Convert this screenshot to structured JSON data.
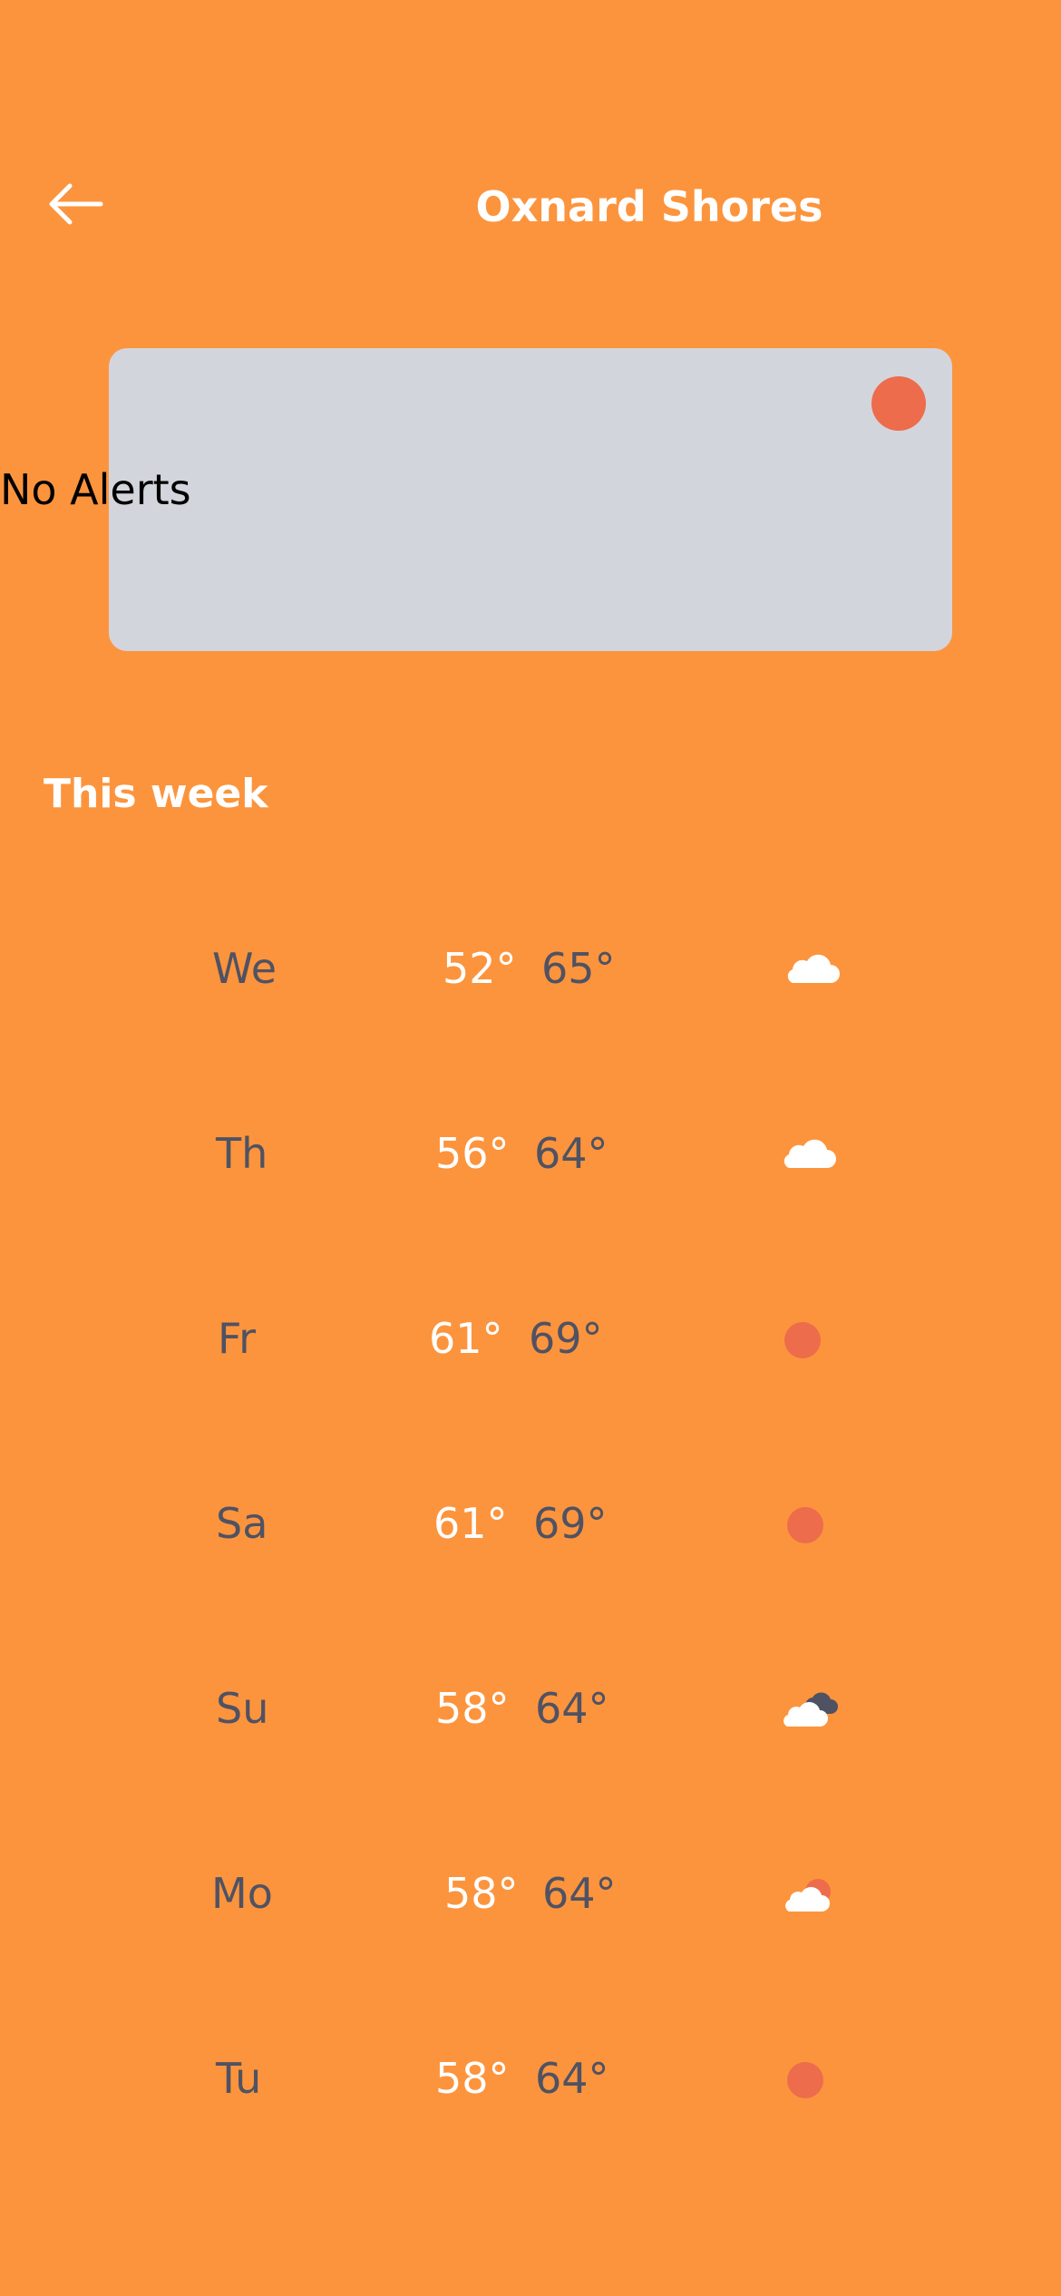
{
  "header": {
    "back_icon": "arrow-left-icon",
    "title": "Oxnard Shores"
  },
  "alerts": {
    "message": "No Alerts",
    "indicator_color": "#ED6C4C"
  },
  "week": {
    "title": "This week",
    "days": [
      {
        "day": "We",
        "low": "52°",
        "high": "65°",
        "icon": "cloud-icon"
      },
      {
        "day": "Th",
        "low": "56°",
        "high": "64°",
        "icon": "cloud-icon"
      },
      {
        "day": "Fr",
        "low": "61°",
        "high": "69°",
        "icon": "sun-icon"
      },
      {
        "day": "Sa",
        "low": "61°",
        "high": "69°",
        "icon": "sun-icon"
      },
      {
        "day": "Su",
        "low": "58°",
        "high": "64°",
        "icon": "cloudy-icon"
      },
      {
        "day": "Mo",
        "low": "58°",
        "high": "64°",
        "icon": "partly-cloudy-icon"
      },
      {
        "day": "Tu",
        "low": "58°",
        "high": "64°",
        "icon": "sun-icon"
      }
    ]
  },
  "colors": {
    "background": "#FC943D",
    "card": "#D3D5DD",
    "text_dark": "#4F5263",
    "text_light": "#FFFFFF",
    "sun": "#ED6C4C"
  }
}
